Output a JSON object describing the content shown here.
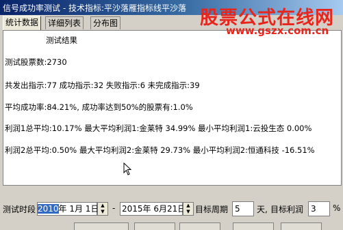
{
  "window": {
    "title": "信号成功率测试 - 技术指标:平沙落雁指标线平沙落"
  },
  "tabs": [
    {
      "label": "统计数据"
    },
    {
      "label": "详细列表"
    },
    {
      "label": "分布图"
    }
  ],
  "results": {
    "heading": "测试结果",
    "lines": [
      "测试股票数:2730",
      "共发出指示:77 成功指示:32 失败指示:6 未完成指示:39",
      "平均成功率:84.21%, 成功率达到50%的股票有:1.0%",
      "利润1总平均:10.17% 最大平均利润1:金莱特   34.99% 最小平均利润1:云投生态 0.00%",
      "利润2总平均:0.50% 最大平均利润2:金莱特   29.73% 最小平均利润2:恒通科技 -16.51%"
    ]
  },
  "controls": {
    "period_label": "测试时段",
    "start_year": "2010",
    "start_rest": "年 1月 1日",
    "dash": "-",
    "end_date": "2015年 6月21日",
    "target_period_label": "目标周期",
    "target_period_value": "5",
    "days_label": "天,",
    "target_profit_label": "目标利润",
    "target_profit_value": "3",
    "percent": "%"
  },
  "watermark": {
    "line1": "股票公式在线网",
    "line2": "www.gszx.com.cn"
  }
}
